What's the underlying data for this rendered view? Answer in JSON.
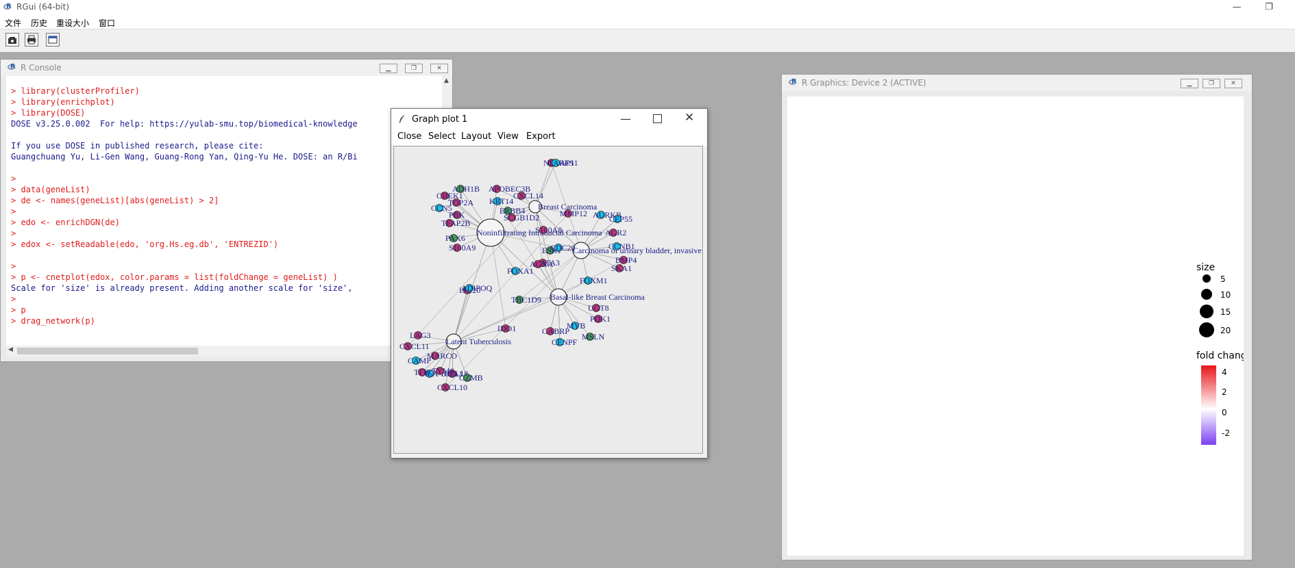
{
  "app": {
    "title": "RGui (64-bit)",
    "menu": [
      "文件",
      "历史",
      "重设大小",
      "窗口"
    ]
  },
  "console": {
    "title": "R Console",
    "lines": [
      {
        "t": "cmd",
        "text": "> library(clusterProfiler)"
      },
      {
        "t": "cmd",
        "text": "> library(enrichplot)"
      },
      {
        "t": "cmd",
        "text": "> library(DOSE)"
      },
      {
        "t": "out",
        "text": "DOSE v3.25.0.002  For help: https://yulab-smu.top/biomedical-knowledge"
      },
      {
        "t": "out",
        "text": ""
      },
      {
        "t": "out",
        "text": "If you use DOSE in published research, please cite:"
      },
      {
        "t": "out",
        "text": "Guangchuang Yu, Li-Gen Wang, Guang-Rong Yan, Qing-Yu He. DOSE: an R/Bi"
      },
      {
        "t": "out",
        "text": ""
      },
      {
        "t": "cmd",
        "text": ">"
      },
      {
        "t": "cmd",
        "text": "> data(geneList)"
      },
      {
        "t": "cmd",
        "text": "> de <- names(geneList)[abs(geneList) > 2]"
      },
      {
        "t": "cmd",
        "text": ">"
      },
      {
        "t": "cmd",
        "text": "> edo <- enrichDGN(de)"
      },
      {
        "t": "cmd",
        "text": ">"
      },
      {
        "t": "cmd",
        "text": "> edox <- setReadable(edo, 'org.Hs.eg.db', 'ENTREZID')"
      },
      {
        "t": "out",
        "text": ""
      },
      {
        "t": "cmd",
        "text": ">"
      },
      {
        "t": "cmd",
        "text": "> p <- cnetplot(edox, color.params = list(foldChange = geneList) )"
      },
      {
        "t": "out",
        "text": "Scale for 'size' is already present. Adding another scale for 'size',"
      },
      {
        "t": "cmd",
        "text": ">"
      },
      {
        "t": "cmd",
        "text": "> p"
      },
      {
        "t": "cmd",
        "text": "> drag_network(p)"
      }
    ]
  },
  "graph_plot": {
    "title": "Graph plot 1",
    "menu": [
      "Close",
      "Select",
      "Layout",
      "View",
      "Export"
    ],
    "categories": [
      "Breast Carcinoma",
      "Noninfiltrating Intraductal Carcinoma",
      "Carcinoma of urinary bladder, invasive",
      "Basal-like Breast Carcinoma",
      "Latent Tuberculosis"
    ],
    "visible_labels": [
      "NUSAP1",
      "CARES1",
      "ADH1B",
      "APOBEC3B",
      "CHEK1",
      "TOP2A",
      "KRT14",
      "CXCL14",
      "CCN5",
      "ERBB4",
      "SCGB1D2",
      "PBK",
      "MMP12",
      "AURKB",
      "TFAP2B",
      "CEP55",
      "PAX6",
      "S100A8",
      "AGR2",
      "S100A9",
      "CCNB1",
      "BMP4",
      "FOXA1",
      "ESR1",
      "GATA3",
      "SKA1",
      "AGXA",
      "FOXM1",
      "ISG20",
      "ADIPOQ",
      "TBC1D9",
      "UGT8",
      "PDK1",
      "IDO1",
      "MYB",
      "GABRP",
      "CENPF",
      "MSLN",
      "LAG3",
      "CXCL11",
      "MARCO",
      "CAMP",
      "CCL18",
      "HLA-DQA1",
      "GZMB",
      "CXCL10",
      "TFRC",
      "TYMS",
      "CDC20"
    ]
  },
  "graphics": {
    "title": "R Graphics: Device 2 (ACTIVE)",
    "legend": {
      "size_title": "size",
      "size_values": [
        "5",
        "10",
        "15",
        "20"
      ],
      "color_title": "fold change",
      "color_values": [
        "4",
        "2",
        "0",
        "-2"
      ],
      "colors": {
        "high": "#e8151a",
        "mid": "#ffffff",
        "low": "#7b3ff2"
      }
    }
  },
  "icons": {
    "app": "r-logo-icon",
    "toolbar": [
      "open-script-icon",
      "print-icon",
      "console-window-icon"
    ],
    "graph_plot": "tk-feather-icon"
  }
}
